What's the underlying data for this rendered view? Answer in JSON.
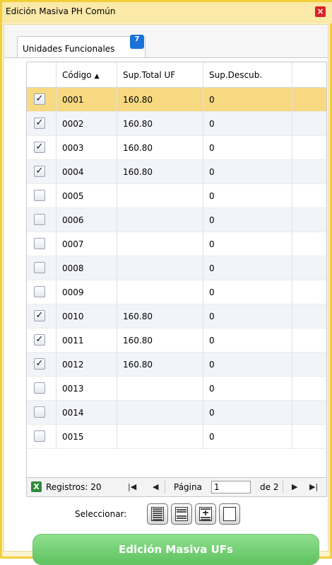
{
  "window": {
    "title": "Edición Masiva PH Común",
    "close_symbol": "×"
  },
  "tab": {
    "label": "Unidades Funcionales",
    "badge": "7"
  },
  "grid": {
    "columns": [
      "Código",
      "Sup.Total UF",
      "Sup.Descub.",
      ""
    ],
    "sort_indicator": "▲",
    "rows": [
      {
        "codigo": "0001",
        "sup_total": "160.80",
        "sup_descub": "0",
        "checked": true,
        "mark": "✓"
      },
      {
        "codigo": "0002",
        "sup_total": "160.80",
        "sup_descub": "0",
        "checked": true,
        "mark": "✓"
      },
      {
        "codigo": "0003",
        "sup_total": "160.80",
        "sup_descub": "0",
        "checked": true,
        "mark": "✓"
      },
      {
        "codigo": "0004",
        "sup_total": "160.80",
        "sup_descub": "0",
        "checked": true,
        "mark": "✓"
      },
      {
        "codigo": "0005",
        "sup_total": "",
        "sup_descub": "0",
        "checked": false,
        "mark": ""
      },
      {
        "codigo": "0006",
        "sup_total": "",
        "sup_descub": "0",
        "checked": false,
        "mark": ""
      },
      {
        "codigo": "0007",
        "sup_total": "",
        "sup_descub": "0",
        "checked": false,
        "mark": ""
      },
      {
        "codigo": "0008",
        "sup_total": "",
        "sup_descub": "0",
        "checked": false,
        "mark": ""
      },
      {
        "codigo": "0009",
        "sup_total": "",
        "sup_descub": "0",
        "checked": false,
        "mark": ""
      },
      {
        "codigo": "0010",
        "sup_total": "160.80",
        "sup_descub": "0",
        "checked": true,
        "mark": "✓"
      },
      {
        "codigo": "0011",
        "sup_total": "160.80",
        "sup_descub": "0",
        "checked": true,
        "mark": "✓"
      },
      {
        "codigo": "0012",
        "sup_total": "160.80",
        "sup_descub": "0",
        "checked": true,
        "mark": "✓"
      },
      {
        "codigo": "0013",
        "sup_total": "",
        "sup_descub": "0",
        "checked": false,
        "mark": ""
      },
      {
        "codigo": "0014",
        "sup_total": "",
        "sup_descub": "0",
        "checked": false,
        "mark": ""
      },
      {
        "codigo": "0015",
        "sup_total": "",
        "sup_descub": "0",
        "checked": false,
        "mark": ""
      }
    ]
  },
  "pager": {
    "excel_icon_glyph": "X",
    "registros_label": "Registros: 20",
    "first_glyph": "|◀",
    "prev_glyph": "◀",
    "pagina_label": "Página",
    "page_value": "1",
    "of_label": "de 2",
    "next_glyph": "▶",
    "last_glyph": "▶|"
  },
  "selection": {
    "label": "Seleccionar:"
  },
  "action": {
    "label": "Edición Masiva UFs"
  },
  "colors": {
    "accent_border": "#f3cd3a",
    "selected_row": "#f7d982",
    "action_button": "#6fcf6f",
    "badge": "#1a73d9",
    "close": "#d9232a"
  },
  "icons": [
    "close-icon",
    "excel-export-icon",
    "first-page-icon",
    "prev-page-icon",
    "next-page-icon",
    "last-page-icon",
    "select-all-icon",
    "select-page-icon",
    "select-filtered-icon",
    "select-none-icon"
  ]
}
